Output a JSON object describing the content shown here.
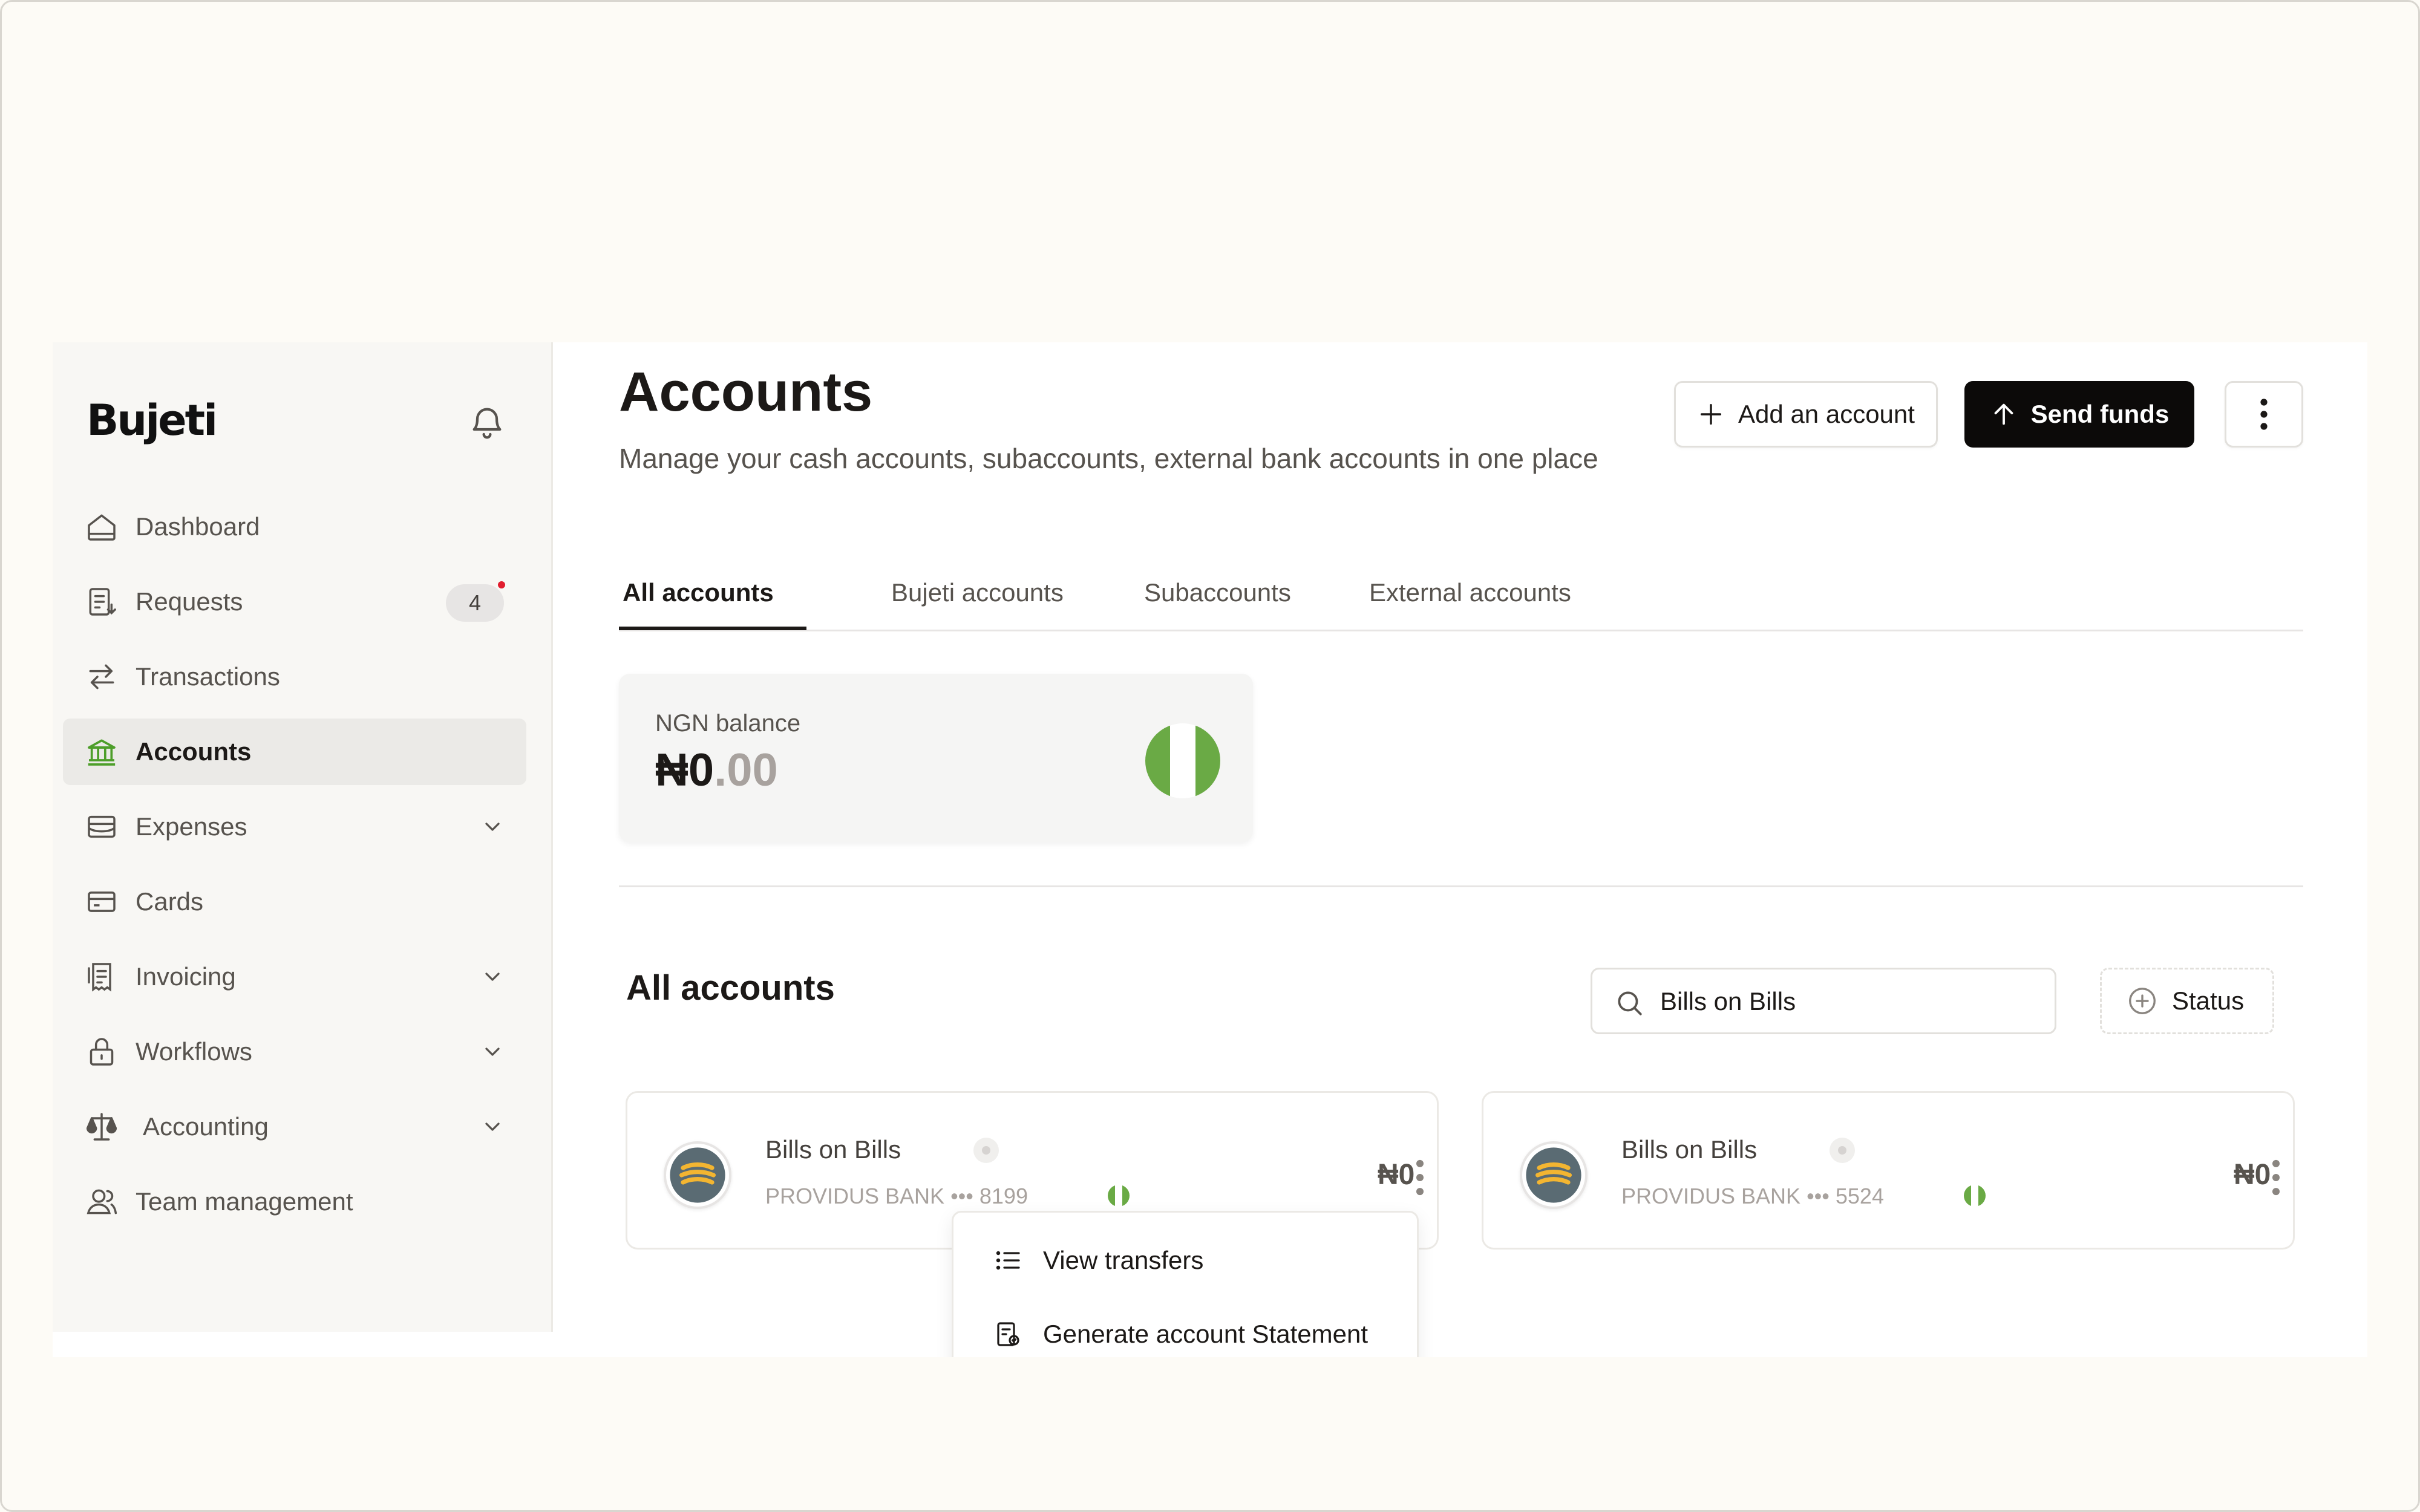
{
  "app": {
    "logo": "Bujeti"
  },
  "sidebar": {
    "items": [
      {
        "label": "Dashboard",
        "icon": "home-icon"
      },
      {
        "label": "Requests",
        "icon": "requests-icon",
        "badge": "4"
      },
      {
        "label": "Transactions",
        "icon": "transfer-arrows-icon"
      },
      {
        "label": "Accounts",
        "icon": "bank-icon",
        "active": true
      },
      {
        "label": "Expenses",
        "icon": "expenses-icon",
        "expandable": true
      },
      {
        "label": "Cards",
        "icon": "card-icon"
      },
      {
        "label": "Invoicing",
        "icon": "invoice-icon",
        "expandable": true
      },
      {
        "label": "Workflows",
        "icon": "lock-icon",
        "expandable": true
      },
      {
        "label": "Accounting",
        "icon": "scale-icon",
        "expandable": true
      },
      {
        "label": "Team management",
        "icon": "team-icon"
      }
    ]
  },
  "header": {
    "title": "Accounts",
    "subtitle": "Manage your cash accounts, subaccounts, external bank accounts in one place",
    "add_account_label": "Add an account",
    "send_funds_label": "Send funds"
  },
  "tabs": [
    {
      "label": "All accounts",
      "active": true
    },
    {
      "label": "Bujeti accounts"
    },
    {
      "label": "Subaccounts"
    },
    {
      "label": "External accounts"
    }
  ],
  "balance": {
    "label": "NGN balance",
    "amount_whole": "₦0",
    "amount_decimal": ".00"
  },
  "section": {
    "title": "All accounts",
    "search_value": "Bills on Bills",
    "status_filter_label": "Status"
  },
  "accounts": [
    {
      "name": "Bills on Bills",
      "bank": "PROVIDUS BANK ••• 8199",
      "amount": "₦0"
    },
    {
      "name": "Bills on Bills",
      "bank": "PROVIDUS BANK ••• 5524",
      "amount": "₦0"
    }
  ],
  "menu": {
    "items": [
      {
        "label": "View transfers",
        "icon": "list-icon"
      },
      {
        "label": "Generate account Statement",
        "icon": "statement-icon"
      }
    ]
  },
  "colors": {
    "accent_green": "#4d9e2a",
    "nigeria_green": "#6aaa45",
    "dark_button": "#0c0a09",
    "notification_red": "#e11d2e"
  }
}
